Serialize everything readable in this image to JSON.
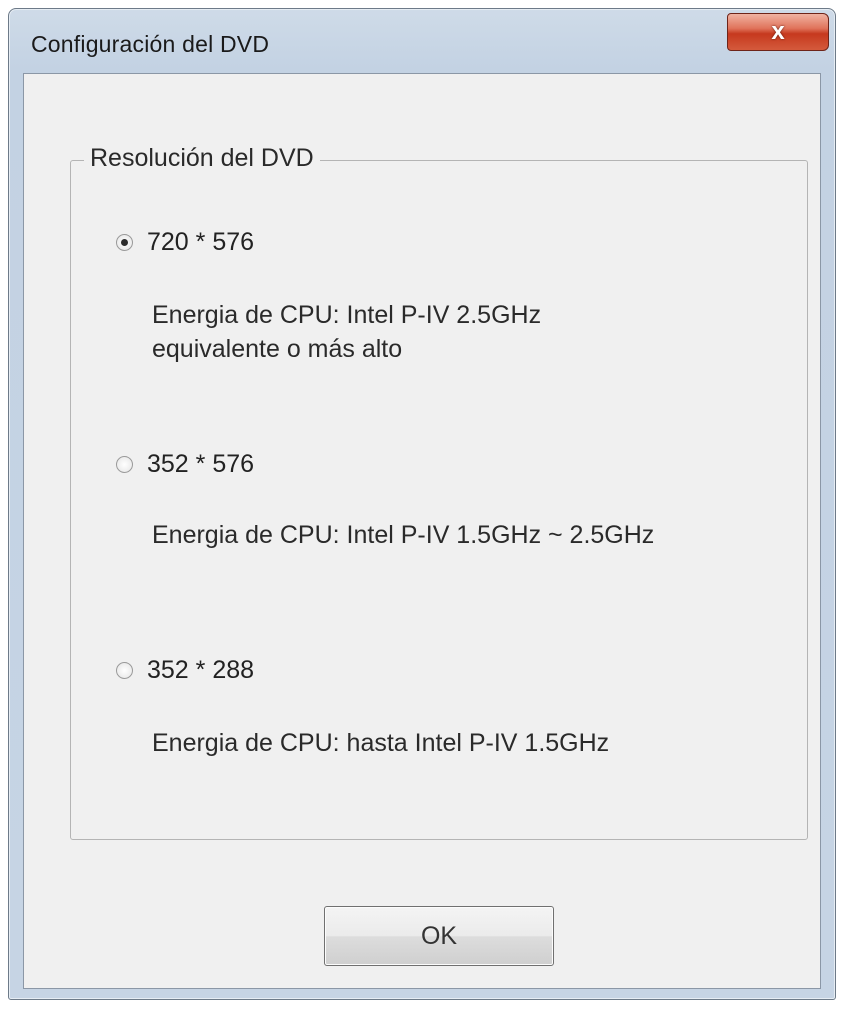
{
  "window": {
    "title": "Configuración del DVD",
    "close_label": "x"
  },
  "group": {
    "legend": "Resolución del DVD"
  },
  "options": [
    {
      "label": "720 * 576",
      "selected": true,
      "desc_line1": "Energia de CPU: Intel P-IV 2.5GHz",
      "desc_line2": "equivalente o más alto"
    },
    {
      "label": "352 * 576",
      "selected": false,
      "desc_line1": "Energia de CPU: Intel P-IV 1.5GHz ~ 2.5GHz",
      "desc_line2": ""
    },
    {
      "label": "352 * 288",
      "selected": false,
      "desc_line1": "Energia de CPU: hasta Intel P-IV 1.5GHz",
      "desc_line2": ""
    }
  ],
  "footer": {
    "ok_label": "OK"
  }
}
